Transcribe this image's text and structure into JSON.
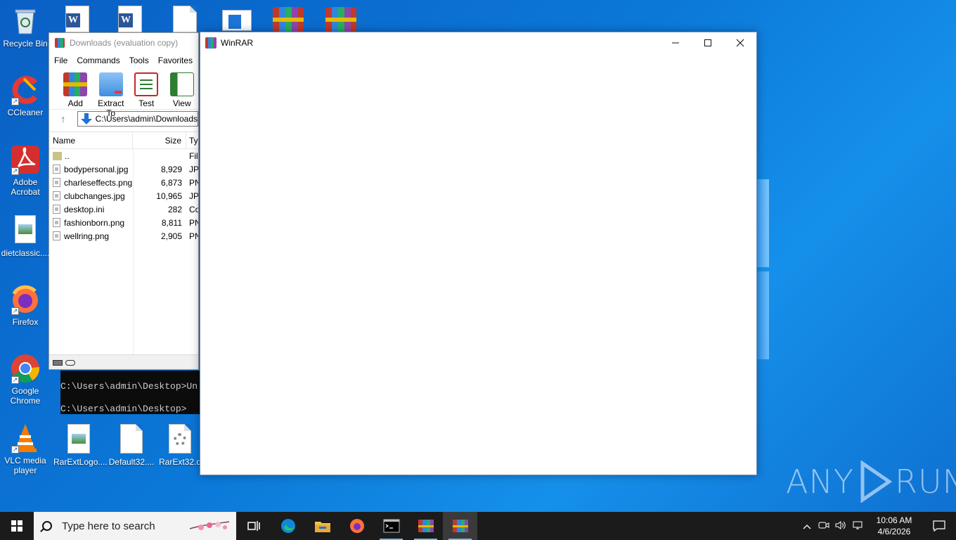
{
  "desktop": {
    "icons_left": [
      {
        "label": "Recycle Bin",
        "icon": "recycle-bin-icon"
      },
      {
        "label": "CCleaner",
        "icon": "ccleaner-icon"
      },
      {
        "label": "Adobe Acrobat",
        "icon": "acrobat-icon"
      },
      {
        "label": "dietclassic....",
        "icon": "image-file-icon"
      },
      {
        "label": "Firefox",
        "icon": "firefox-icon"
      },
      {
        "label": "Google Chrome",
        "icon": "chrome-icon"
      },
      {
        "label": "VLC media player",
        "icon": "vlc-icon"
      }
    ],
    "icons_bottom": [
      {
        "label": "RarExtLogo...."
      },
      {
        "label": "Default32...."
      },
      {
        "label": "RarExt32.d"
      }
    ]
  },
  "winrar_back": {
    "title": "Downloads (evaluation copy)",
    "menu": [
      "File",
      "Commands",
      "Tools",
      "Favorites"
    ],
    "toolbar": [
      {
        "label": "Add",
        "icon": "add-archive-icon"
      },
      {
        "label": "Extract To",
        "icon": "extract-folder-icon"
      },
      {
        "label": "Test",
        "icon": "test-checklist-icon"
      },
      {
        "label": "View",
        "icon": "view-book-icon"
      }
    ],
    "address": "C:\\Users\\admin\\Downloads",
    "columns": {
      "name": "Name",
      "size": "Size",
      "type": "Type"
    },
    "files": [
      {
        "name": "..",
        "size": "",
        "type": "File folder"
      },
      {
        "name": "bodypersonal.jpg",
        "size": "8,929",
        "type": "JPG"
      },
      {
        "name": "charleseffects.png",
        "size": "6,873",
        "type": "PNG"
      },
      {
        "name": "clubchanges.jpg",
        "size": "10,965",
        "type": "JPG"
      },
      {
        "name": "desktop.ini",
        "size": "282",
        "type": "Configuration"
      },
      {
        "name": "fashionborn.png",
        "size": "8,811",
        "type": "PNG"
      },
      {
        "name": "wellring.png",
        "size": "2,905",
        "type": "PNG"
      }
    ]
  },
  "console": {
    "line1": "C:\\Users\\admin\\Desktop>Un",
    "line2": "C:\\Users\\admin\\Desktop>"
  },
  "winrar_front": {
    "title": "WinRAR",
    "minimize": "—",
    "maximize": "☐",
    "close": "✕"
  },
  "watermark": {
    "left": "ANY",
    "right": "RUN"
  },
  "taskbar": {
    "search_placeholder": "Type here to search",
    "clock_time": "10:06 AM",
    "clock_date": "4/6/2026"
  }
}
